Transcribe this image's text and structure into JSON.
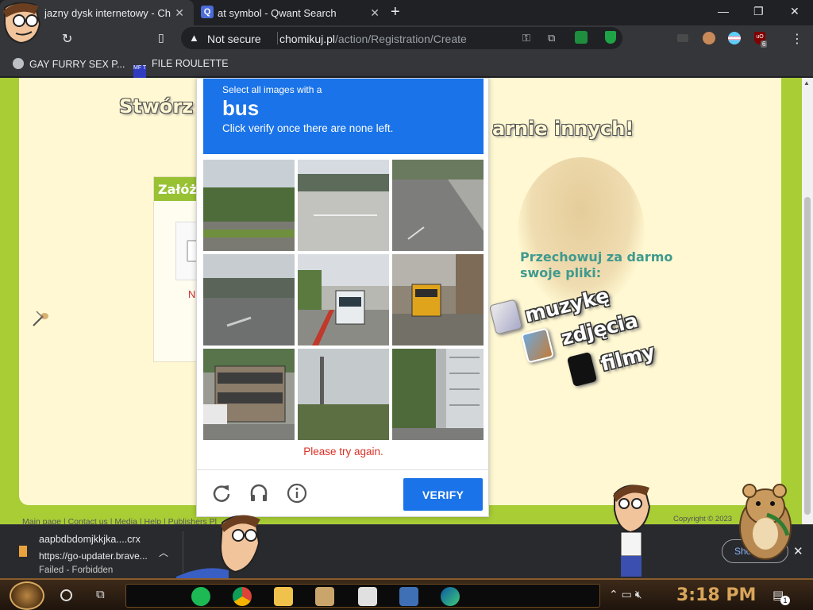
{
  "tabs": [
    {
      "label": "jazny dysk internetowy - Ch",
      "active": true
    },
    {
      "label": "at symbol - Qwant Search",
      "active": false
    }
  ],
  "window_controls": {
    "minimize": "—",
    "maximize": "❐",
    "close": "✕"
  },
  "toolbar": {
    "security_label": "Not secure",
    "url_host": "chomikuj.pl",
    "url_path": "/action/Registration/Create",
    "ublock_label": "uO",
    "ublock_count": "6"
  },
  "bookmarks": [
    {
      "label": "GAY FURRY SEX P...",
      "icon": "globe-icon"
    },
    {
      "label": "FILE ROULETTE",
      "icon": "mft-icon",
      "icon_text": "MF T"
    }
  ],
  "page": {
    "headline_left": "Stwórz",
    "headline_right": "arnie innych!",
    "registration_title": "Załóż ko",
    "error_fragment": "Niepo",
    "side_tagline": [
      "Przechowuj za darmo",
      "swoje pliki:"
    ],
    "media_words": [
      "muzykę",
      "zdjęcia",
      "filmy"
    ],
    "footer_links": "Main page | Contact us | Media | Help | Publishers Pl",
    "copyright": "Copyright © 2023"
  },
  "captcha": {
    "instruction_line1": "Select all images with a",
    "target_word": "bus",
    "instruction_line2": "Click verify once there are none left.",
    "error_message": "Please try again.",
    "verify_label": "VERIFY",
    "tiles": [
      {
        "scene": "road-with-trees"
      },
      {
        "scene": "highway-overpass"
      },
      {
        "scene": "street-sidewalk"
      },
      {
        "scene": "crosswalk-parking"
      },
      {
        "scene": "bus-on-road"
      },
      {
        "scene": "yellow-school-bus"
      },
      {
        "scene": "double-decker-bus"
      },
      {
        "scene": "trees-pole"
      },
      {
        "scene": "city-buildings"
      }
    ]
  },
  "downloads": {
    "filename": "aapbdbdomjkkjka....crx",
    "url": "https://go-updater.brave...",
    "status": "Failed - Forbidden",
    "show_all_label": "Show"
  },
  "taskbar": {
    "clock": "3:18 PM",
    "notification_count": "1"
  },
  "colors": {
    "captcha_blue": "#1a73e8",
    "page_green": "#a8cd35",
    "page_cream": "#fff8d2",
    "error_red": "#d93025"
  }
}
